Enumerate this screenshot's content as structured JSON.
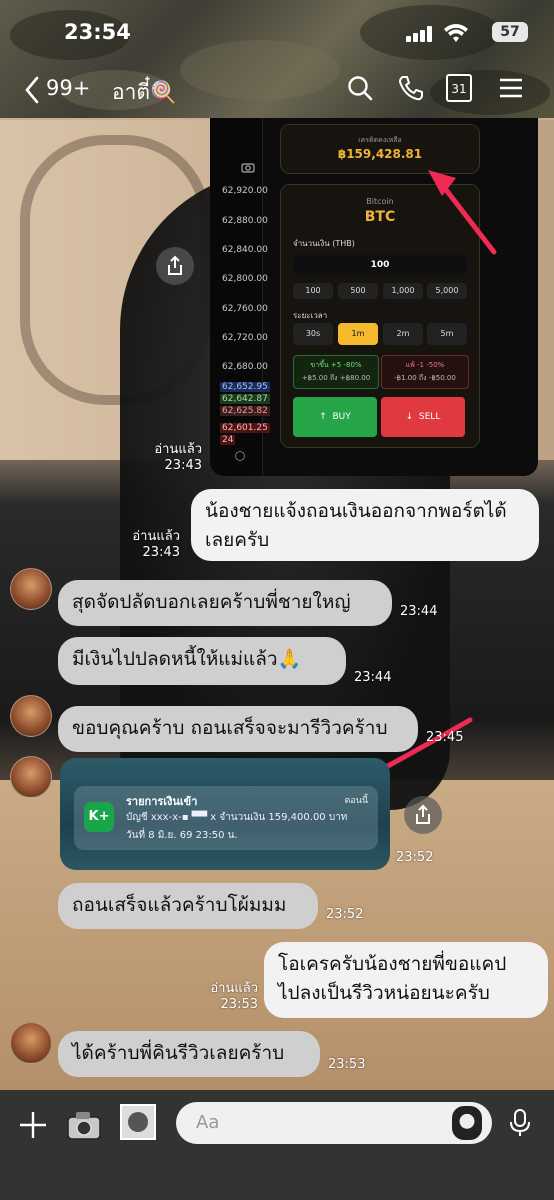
{
  "status_bar": {
    "time": "23:54",
    "battery": "57"
  },
  "header": {
    "back_count": "99+",
    "chat_name": "อาตี๋🍭",
    "calendar_day": "31"
  },
  "crypto": {
    "ladder_prices": [
      "62,920.00",
      "62,880.00",
      "62,840.00",
      "62,800.00",
      "62,760.00",
      "62,720.00",
      "62,680.00"
    ],
    "ladder_tags": [
      "62,652.95",
      "62,642.87",
      "62,625.82",
      "62,601.25",
      "24"
    ],
    "balance_label": "เครดิตคงเหลือ",
    "balance": "฿159,428.81",
    "asset_sub": "Bitcoin",
    "asset": "BTC",
    "amount_label": "จำนวนเงิน (THB)",
    "amount_value": "100",
    "amount_chips": [
      "100",
      "500",
      "1,000",
      "5,000"
    ],
    "duration_label": "ระยะเวลา",
    "duration_chips": [
      "30s",
      "1m",
      "2m",
      "5m"
    ],
    "up_title": "ขาขึ้น +5 -80%",
    "up_range": "+฿5.00 ถึง +฿80.00",
    "down_title": "แพ้ -1 -50%",
    "down_range": "-฿1.00 ถึง -฿50.00",
    "buy_label": "BUY",
    "sell_label": "SELL"
  },
  "messages": {
    "read1": "อ่านแล้ว",
    "read1_time": "23:43",
    "out1": "น้องชายแจ้งถอนเงินออกจากพอร์ตได้เลยครับ",
    "read2": "อ่านแล้ว",
    "read2_time": "23:43",
    "in1": "สุดจัดปลัดบอกเลยคร้าบพี่ชายใหญ่",
    "in1_time": "23:44",
    "in2": "มีเงินไปปลดหนี้ให้แม่แล้ว🙏",
    "in2_time": "23:44",
    "in3": "ขอบคุณคร้าบ ถอนเสร็จจะมารีวิวคร้าบ",
    "in3_time": "23:45",
    "kbank_logo": "K+",
    "kbank_title": "รายการเงินเข้า",
    "kbank_now": "ตอนนี้",
    "kbank_line1": "บัญชี xxx-x-▪ ▀▀ x จำนวนเงิน 159,400.00 บาท",
    "kbank_line2": "วันที่ 8 มิ.ย. 69 23:50 น.",
    "kbank_time": "23:52",
    "in4": "ถอนเสร็จแล้วคร้าบโผ้มมม",
    "in4_time": "23:52",
    "read3": "อ่านแล้ว",
    "read3_time": "23:53",
    "out2_line1": "โอเครครับน้องชายพี่ขอแคป",
    "out2_line2": "ไปลงเป็นรีวิวหน่อยนะครับ",
    "in5": "ได้คร้าบพี่คินรีวิวเลยคร้าบ",
    "in5_time": "23:53"
  },
  "input": {
    "placeholder": "Aa"
  }
}
